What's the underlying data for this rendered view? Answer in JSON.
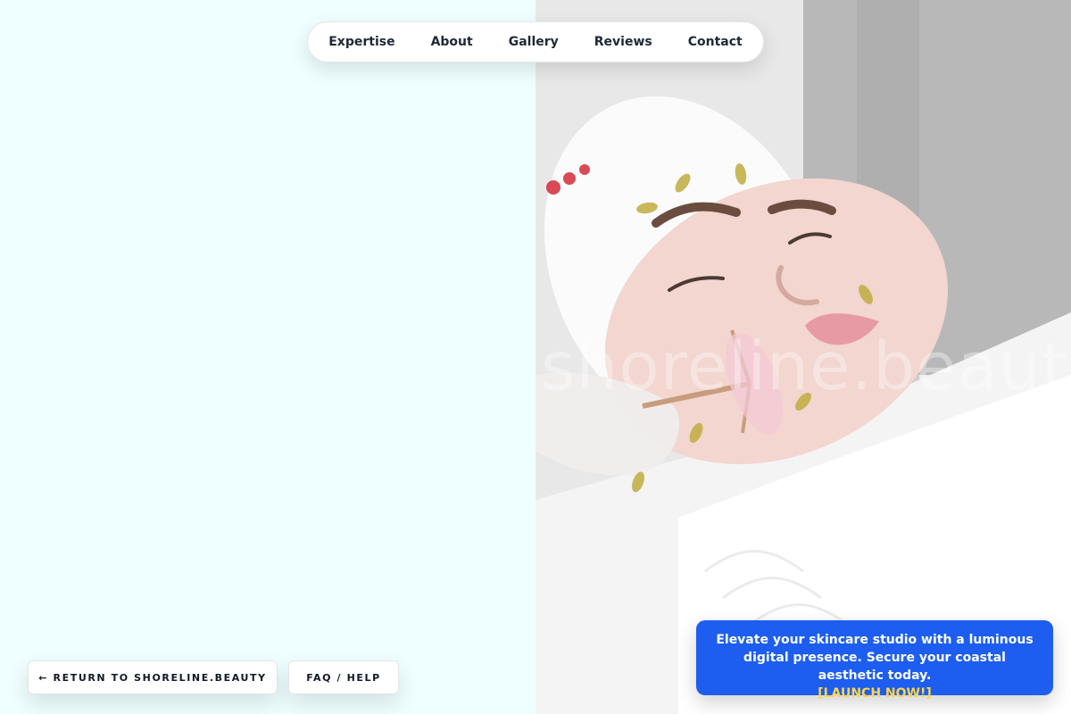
{
  "nav": {
    "items": [
      {
        "label": "Expertise"
      },
      {
        "label": "About"
      },
      {
        "label": "Gallery"
      },
      {
        "label": "Reviews"
      },
      {
        "label": "Contact"
      }
    ]
  },
  "hero_image": {
    "watermark": "shoreline.beauty"
  },
  "buttons": {
    "return_label": "← RETURN TO SHORELINE.BEAUTY",
    "faq_label": "FAQ / HELP"
  },
  "promo": {
    "message": "Elevate your skincare studio with a luminous digital presence. Secure your coastal aesthetic today.",
    "cta": "[LAUNCH NOW!]"
  },
  "colors": {
    "left_background": "#efffff",
    "promo_background": "#1d5ef0",
    "promo_cta": "#ffd54a"
  }
}
